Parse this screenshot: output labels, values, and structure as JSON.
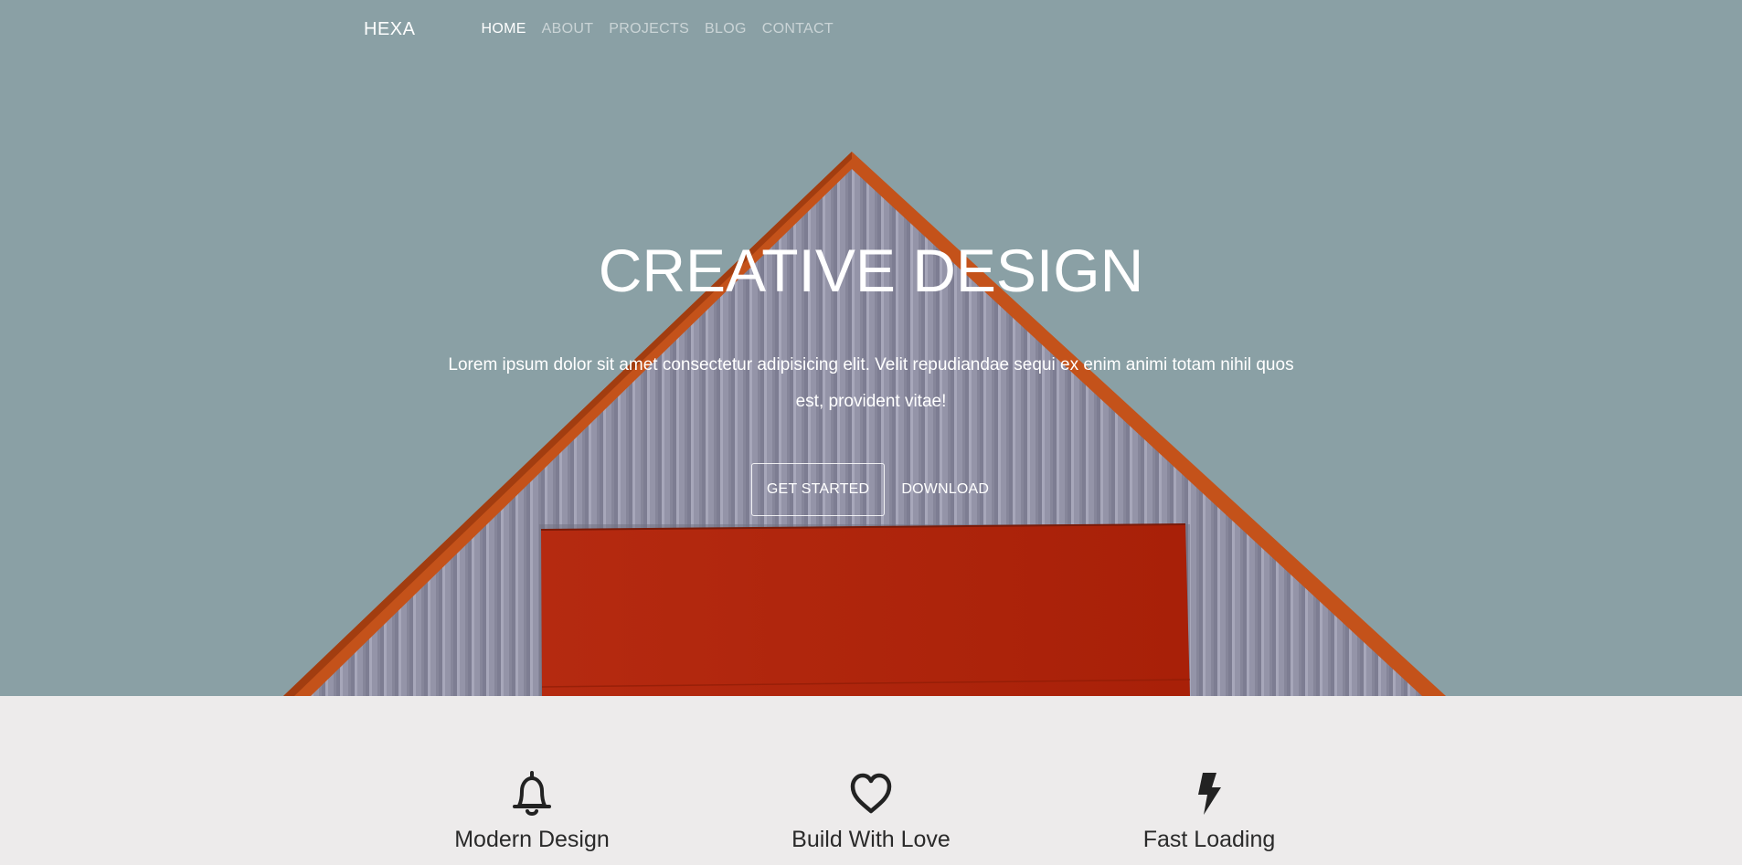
{
  "nav": {
    "brand": "HEXA",
    "items": [
      {
        "label": "HOME",
        "active": true
      },
      {
        "label": "ABOUT",
        "active": false
      },
      {
        "label": "PROJECTS",
        "active": false
      },
      {
        "label": "BLOG",
        "active": false
      },
      {
        "label": "CONTACT",
        "active": false
      }
    ]
  },
  "hero": {
    "title": "CREATIVE DESIGN",
    "description": "Lorem ipsum dolor sit amet consectetur adipisicing elit. Velit repudiandae sequi ex enim animi totam nihil quos est, provident vitae!",
    "primary_button": "GET STARTED",
    "secondary_button": "DOWNLOAD"
  },
  "features": [
    {
      "icon": "bell-icon",
      "title": "Modern Design"
    },
    {
      "icon": "heart-icon",
      "title": "Build With Love"
    },
    {
      "icon": "lightning-icon",
      "title": "Fast Loading"
    }
  ],
  "colors": {
    "sky": "#8aa0a5",
    "roof_trim": "#c4521a",
    "siding": "#8f8fa3",
    "red_panel": "#b32510",
    "features_bg": "#edebeb",
    "icon": "#222222"
  }
}
